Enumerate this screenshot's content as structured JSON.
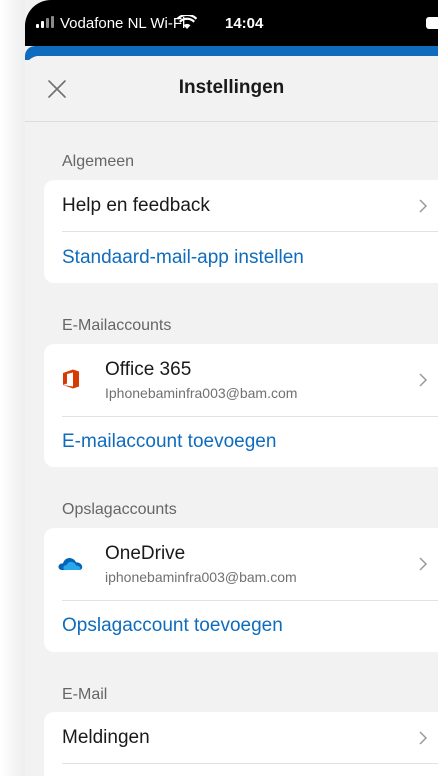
{
  "status_bar": {
    "carrier": "Vodafone NL Wi-Fi",
    "time": "14:04"
  },
  "nav": {
    "title": "Instellingen"
  },
  "sections": {
    "general": {
      "header": "Algemeen",
      "help_label": "Help en feedback",
      "default_mail_link": "Standaard-mail-app instellen"
    },
    "mail_accounts": {
      "header": "E-Mailaccounts",
      "account_name": "Office 365",
      "account_email": "Iphonebaminfra003@bam.com",
      "add_link": "E-mailaccount toevoegen"
    },
    "storage_accounts": {
      "header": "Opslagaccounts",
      "account_name": "OneDrive",
      "account_email": "iphonebaminfra003@bam.com",
      "add_link": "Opslagaccount toevoegen"
    },
    "email": {
      "header": "E-Mail",
      "notifications_label": "Meldingen"
    }
  },
  "colors": {
    "accent": "#0f6cbd",
    "office_red": "#d83b01",
    "onedrive_blue": "#0364b8"
  }
}
